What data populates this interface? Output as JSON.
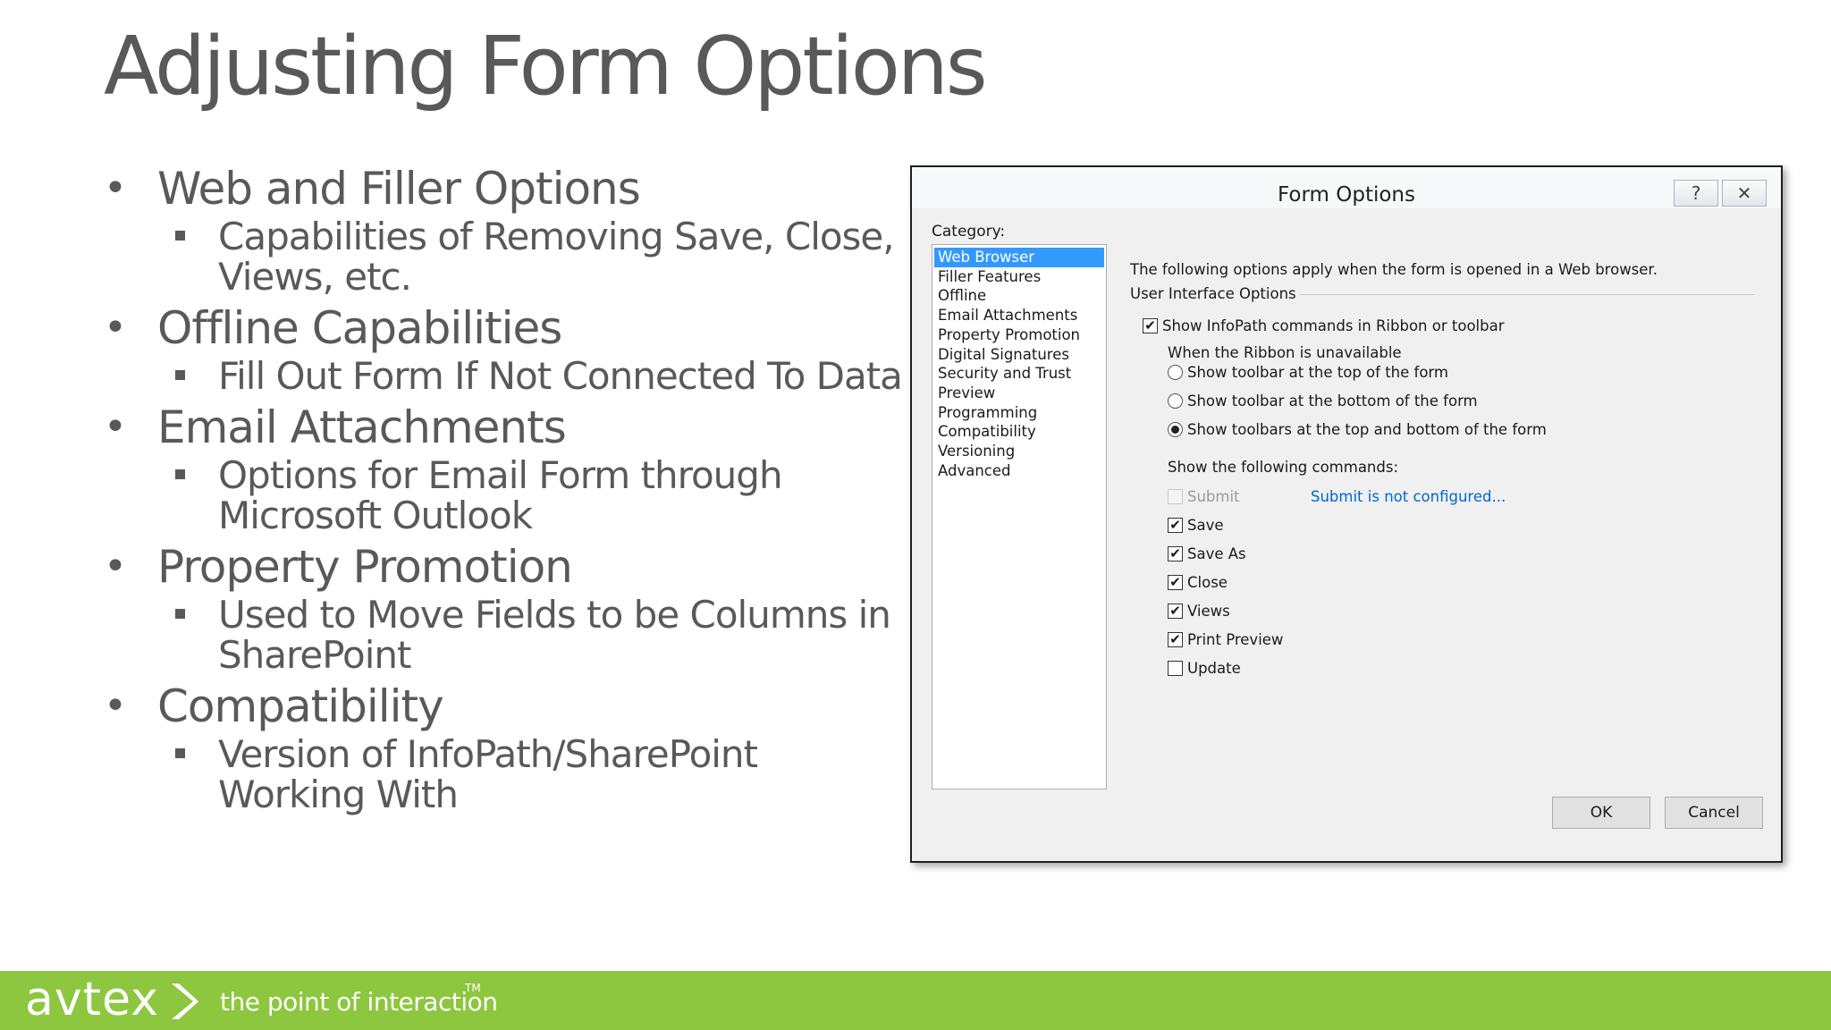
{
  "slide": {
    "title": "Adjusting Form Options",
    "bullets": [
      {
        "text": "Web and Filler Options",
        "sub": "Capabilities of Removing Save, Close, Views, etc."
      },
      {
        "text": "Offline Capabilities",
        "sub": "Fill Out Form If Not Connected To Data"
      },
      {
        "text": "Email Attachments",
        "sub": "Options for Email Form through Microsoft Outlook"
      },
      {
        "text": "Property Promotion",
        "sub": "Used to Move Fields to be Columns in SharePoint"
      },
      {
        "text": "Compatibility",
        "sub": "Version of InfoPath/SharePoint Working With"
      }
    ]
  },
  "dialog": {
    "title": "Form Options",
    "help_icon": "?",
    "close_icon": "✕",
    "category_label": "Category:",
    "categories": [
      "Web Browser",
      "Filler Features",
      "Offline",
      "Email Attachments",
      "Property Promotion",
      "Digital Signatures",
      "Security and Trust",
      "Preview",
      "Programming",
      "Compatibility",
      "Versioning",
      "Advanced"
    ],
    "selected_category": "Web Browser",
    "intro": "The following options apply when the form is opened in a Web browser.",
    "group_label": "User Interface Options",
    "show_commands_checkbox": {
      "label": "Show InfoPath commands in Ribbon or toolbar",
      "checked": true
    },
    "ribbon_unavailable_label": "When the Ribbon is unavailable",
    "radios": [
      {
        "label": "Show toolbar at the top of the form",
        "selected": false
      },
      {
        "label": "Show toolbar at the bottom of the form",
        "selected": false
      },
      {
        "label": "Show toolbars at the top and bottom of the form",
        "selected": true
      }
    ],
    "show_following_label": "Show the following commands:",
    "commands": [
      {
        "label": "Submit",
        "checked": false,
        "disabled": true
      },
      {
        "label": "Save",
        "checked": true,
        "disabled": false
      },
      {
        "label": "Save As",
        "checked": true,
        "disabled": false
      },
      {
        "label": "Close",
        "checked": true,
        "disabled": false
      },
      {
        "label": "Views",
        "checked": true,
        "disabled": false
      },
      {
        "label": "Print Preview",
        "checked": true,
        "disabled": false
      },
      {
        "label": "Update",
        "checked": false,
        "disabled": false
      }
    ],
    "submit_link": "Submit is not configured...",
    "ok_label": "OK",
    "cancel_label": "Cancel",
    "check_glyph": "✔"
  },
  "footer": {
    "logo": "avtex",
    "tagline": "the point of interaction",
    "trademark": "TM",
    "brand_color": "#8dc63f"
  }
}
